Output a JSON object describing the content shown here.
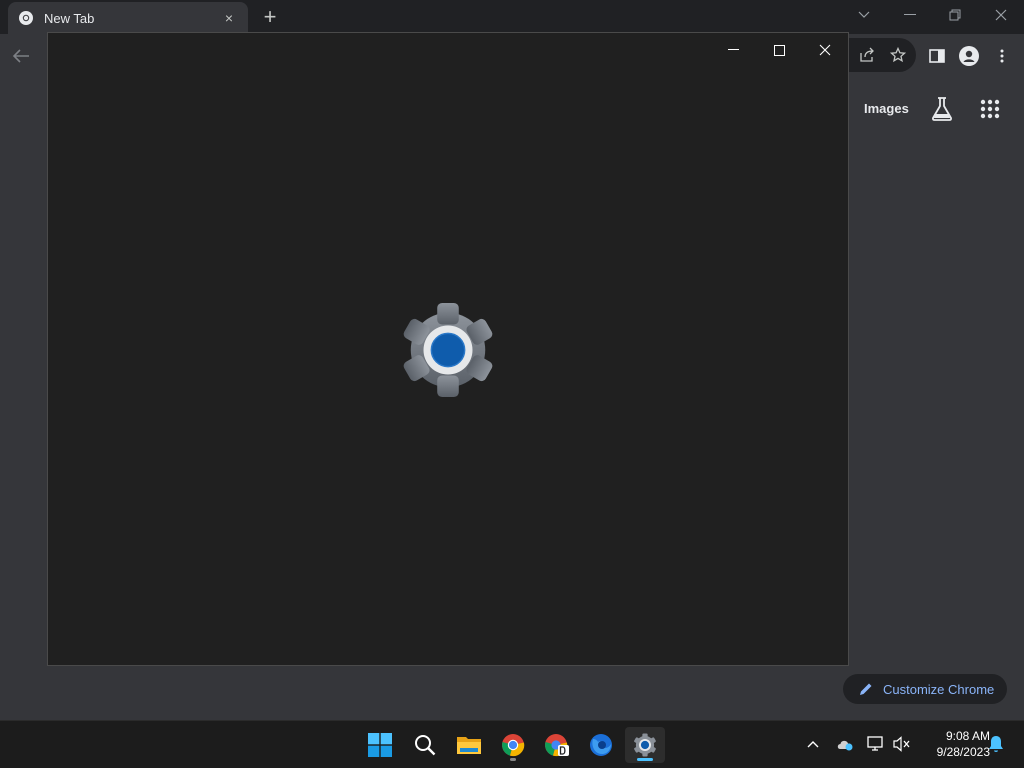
{
  "browser": {
    "tab": {
      "title": "New Tab",
      "close_symbol": "×"
    },
    "new_tab_symbol": "+",
    "ntp": {
      "images_label": "Images",
      "customize_label": "Customize Chrome"
    }
  },
  "taskbar": {
    "apps": [
      {
        "name": "start",
        "icon": "windows-start-icon"
      },
      {
        "name": "search",
        "icon": "search-icon"
      },
      {
        "name": "file-explorer",
        "icon": "folder-icon"
      },
      {
        "name": "chrome",
        "icon": "chrome-icon"
      },
      {
        "name": "chrome-dev",
        "icon": "chrome-dev-icon"
      },
      {
        "name": "firefox",
        "icon": "firefox-icon"
      },
      {
        "name": "settings",
        "icon": "gear-icon",
        "active": true
      }
    ],
    "clock": {
      "time": "9:08 AM",
      "date": "9/28/2023"
    }
  },
  "colors": {
    "accent": "#4cc2ff",
    "link": "#8ab4f8",
    "settings_blue": "#0f5cac"
  }
}
